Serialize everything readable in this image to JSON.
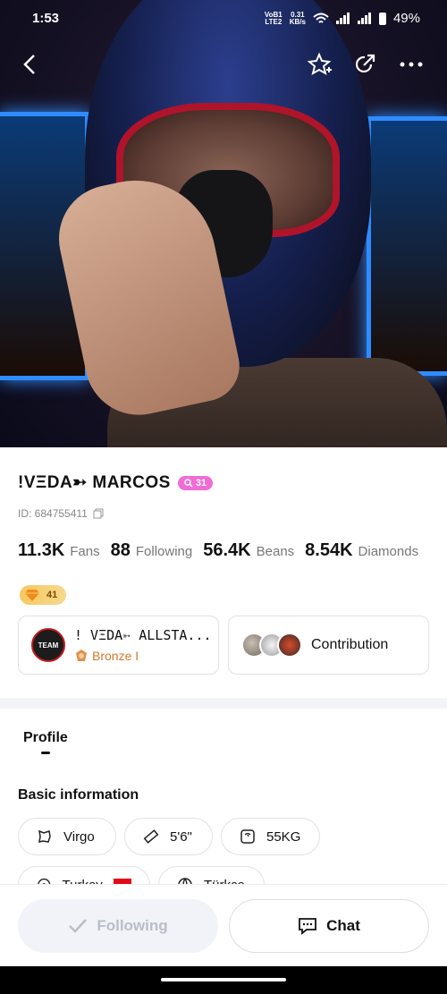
{
  "status_bar": {
    "time": "1:53",
    "network_top": "VoB1",
    "network_bottom": "LTE2",
    "speed_value": "0.31",
    "speed_unit": "KB/s",
    "battery": "49%"
  },
  "top_bar": {
    "back_icon": "chevron-left-icon",
    "star_icon": "star-plus-icon",
    "share_icon": "share-icon",
    "more_icon": "more-dots-icon"
  },
  "profile": {
    "name": "!VΞDA➳ MARCOS",
    "level": "31",
    "level_color": "#f06cd6",
    "id_text": "ID: 684755411",
    "stats": {
      "fans_value": "11.3K",
      "fans_label": "Fans",
      "following_value": "88",
      "following_label": "Following",
      "beans_value": "56.4K",
      "beans_label": "Beans",
      "diamonds_value": "8.54K",
      "diamonds_label": "Diamonds"
    },
    "wealth_level": "41"
  },
  "team": {
    "logo_text": "TEAM",
    "name": "! VΞDA➳ ALLSTA...",
    "rank": "Bronze I",
    "rank_color": "#d17a2a"
  },
  "contribution": {
    "label": "Contribution"
  },
  "tabs": {
    "profile": "Profile"
  },
  "basic_info": {
    "title": "Basic information",
    "chips": [
      {
        "icon": "zodiac-icon",
        "label": "Virgo"
      },
      {
        "icon": "ruler-icon",
        "label": "5'6\""
      },
      {
        "icon": "scale-icon",
        "label": "55KG"
      },
      {
        "icon": "location-icon",
        "label": "Turkey"
      },
      {
        "icon": "globe-icon",
        "label": "Türkçe"
      }
    ]
  },
  "actions": {
    "following": "Following",
    "chat": "Chat"
  }
}
